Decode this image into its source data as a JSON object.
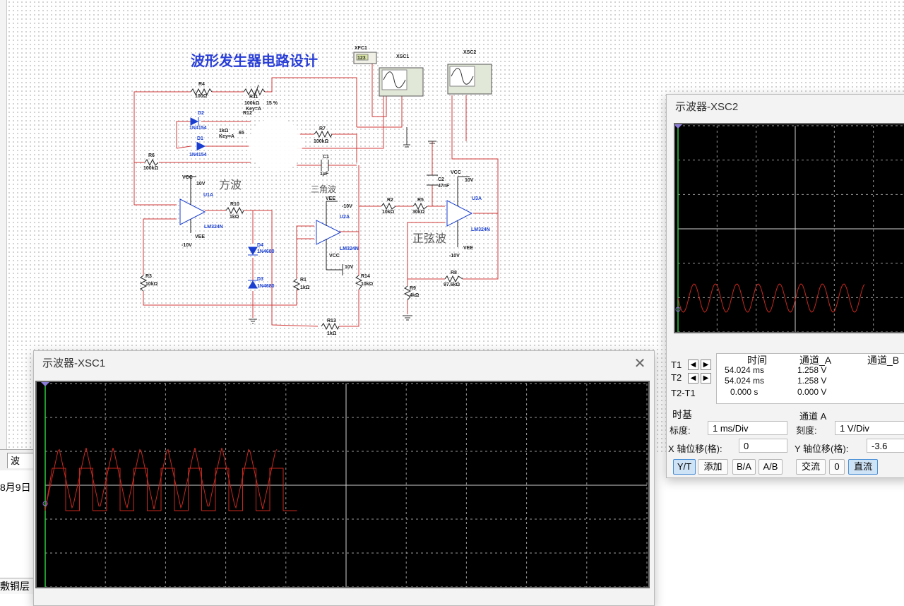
{
  "schematic": {
    "title": "波形发生器电路设计",
    "labels": {
      "square": "方波",
      "triangle": "三角波",
      "sine": "正弦波"
    },
    "components": {
      "R4": {
        "ref": "R4",
        "value": "100Ω"
      },
      "R11": {
        "ref": "R11",
        "value": "100kΩ",
        "key": "Key=A",
        "percent": "15 %"
      },
      "R12": {
        "ref": "R12",
        "value": "1kΩ",
        "key": "Key=A",
        "percent": "65"
      },
      "D2": {
        "ref": "D2",
        "model": "1N4154"
      },
      "D1": {
        "ref": "D1",
        "model": "1N4154"
      },
      "R7": {
        "ref": "R7",
        "value": "100kΩ"
      },
      "C1": {
        "ref": "C1",
        "value": "1µF"
      },
      "R6": {
        "ref": "R6",
        "value": "100kΩ"
      },
      "U1A": {
        "ref": "U1A",
        "model": "LM324N"
      },
      "U2A": {
        "ref": "U2A",
        "model": "LM324N"
      },
      "U3A": {
        "ref": "U3A",
        "model": "LM324N"
      },
      "R10": {
        "ref": "R10",
        "value": "1kΩ"
      },
      "D4": {
        "ref": "D4",
        "model": "1N4680"
      },
      "D3": {
        "ref": "D3",
        "model": "1N4680"
      },
      "R3": {
        "ref": "R3",
        "value": "10kΩ"
      },
      "R1": {
        "ref": "R1",
        "value": "1kΩ"
      },
      "R14": {
        "ref": "R14",
        "value": "10kΩ"
      },
      "R13": {
        "ref": "R13",
        "value": "1kΩ"
      },
      "R2": {
        "ref": "R2",
        "value": "10kΩ"
      },
      "R5": {
        "ref": "R5",
        "value": "30kΩ"
      },
      "C2": {
        "ref": "C2",
        "value": "47nF"
      },
      "R8": {
        "ref": "R8",
        "value": "97.6kΩ"
      },
      "R9": {
        "ref": "R9",
        "value": "4kΩ"
      }
    },
    "supplies": {
      "vcc": "VCC",
      "vee": "VEE",
      "pos": "10V",
      "neg": "-10V"
    },
    "instruments": {
      "xfc1": "XFC1",
      "xfc1_display": "123",
      "xsc1": "XSC1",
      "xsc2": "XSC2"
    }
  },
  "left_panel": {
    "tab_label": "波",
    "date_text": "8月9日",
    "status_text": "敷铜层"
  },
  "osc1": {
    "title": "示波器-XSC1",
    "close": "✕"
  },
  "osc2": {
    "title": "示波器-XSC2",
    "readout": {
      "headers": [
        "时间",
        "通道_A",
        "通道_B"
      ],
      "rows": [
        {
          "label": "T1",
          "time": "54.024 ms",
          "a": "1.258 V"
        },
        {
          "label": "T2",
          "time": "54.024 ms",
          "a": "1.258 V"
        },
        {
          "label": "T2-T1",
          "time": "0.000 s",
          "a": "0.000 V"
        }
      ]
    },
    "timebase": {
      "header": "时基",
      "scale_label": "标度:",
      "scale_value": "1 ms/Div",
      "xpos_label": "X 轴位移(格):",
      "xpos_value": "0",
      "buttons": [
        "Y/T",
        "添加",
        "B/A",
        "A/B"
      ]
    },
    "channel_a": {
      "header": "通道 A",
      "scale_label": "刻度:",
      "scale_value": "1  V/Div",
      "ypos_label": "Y 轴位移(格):",
      "ypos_value": "-3.6",
      "buttons": [
        "交流",
        "0",
        "直流"
      ]
    }
  },
  "colors": {
    "trace": "#c8281e",
    "wire": "#d33a3a",
    "component": "#1a3fd0",
    "grid": "#b5b5b5"
  }
}
